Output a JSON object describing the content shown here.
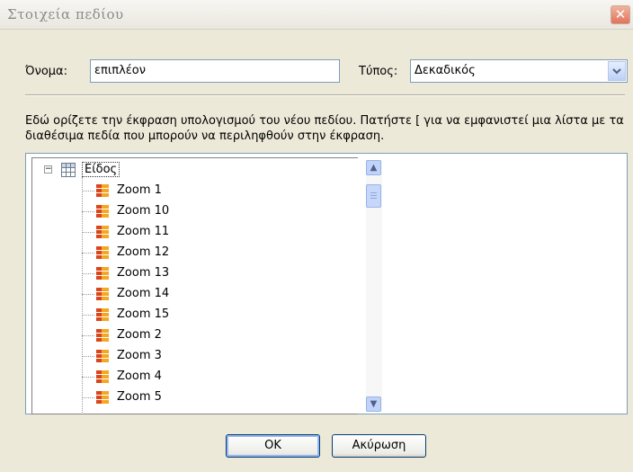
{
  "window": {
    "title": "Στοιχεία πεδίου",
    "close_glyph": "✕"
  },
  "form": {
    "name_label": "Όνομα:",
    "name_value": "επιπλέον",
    "type_label": "Τύπος:",
    "type_value": "Δεκαδικός"
  },
  "description": "Εδώ ορίζετε την έκφραση υπολογισμού του νέου πεδίου. Πατήστε [ για να εμφανιστεί μια λίστα με τα διαθέσιμα πεδία που μπορούν να περιληφθούν στην έκφραση.",
  "expression_value": "",
  "field_list": {
    "expander": "−",
    "root_label": "Είδος",
    "items": [
      "Zoom 1",
      "Zoom 10",
      "Zoom 11",
      "Zoom 12",
      "Zoom 13",
      "Zoom 14",
      "Zoom 15",
      "Zoom 2",
      "Zoom 3",
      "Zoom 4",
      "Zoom 5"
    ],
    "scroll_up": "▲",
    "scroll_down": "▼",
    "root_icon": "table-grid-icon",
    "item_icon": "field-icon"
  },
  "buttons": {
    "ok": "OK",
    "cancel": "Ακύρωση"
  },
  "colors": {
    "border": "#7f9db9",
    "button_border": "#003c74",
    "field_icon_orange": "#f5a623",
    "field_icon_red": "#d9461c"
  }
}
